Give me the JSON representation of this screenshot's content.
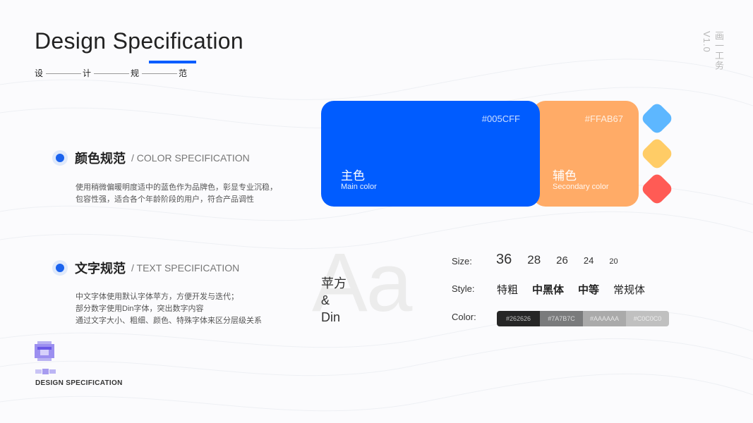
{
  "header": {
    "title": "Design Specification",
    "subtitle_chars": [
      "设",
      "计",
      "规",
      "范"
    ],
    "vertical_tag": "画一工务 V1.0"
  },
  "color_section": {
    "title_cn": "颜色规范",
    "title_en": "/ COLOR SPECIFICATION",
    "desc": [
      "使用稍微偏暖明度适中的蓝色作为品牌色，彰显专业沉稳，",
      "包容性强，适合各个年龄阶段的用户，符合产品调性"
    ],
    "primary": {
      "hex": "#005CFF",
      "cn": "主色",
      "en": "Main color",
      "color": "#005CFF"
    },
    "secondary": {
      "hex": "#FFAB67",
      "cn": "辅色",
      "en": "Secondary color",
      "color": "#FFAB67"
    },
    "swatches": [
      "#5DB7FF",
      "#FFCC66",
      "#FF5B55"
    ]
  },
  "text_section": {
    "title_cn": "文字规范",
    "title_en": "/ TEXT SPECIFICATION",
    "desc": [
      "中文字体使用默认字体苹方，方便开发与迭代；",
      "部分数字使用Din字体，突出数字内容",
      "通过文字大小、粗细、颜色、特殊字体来区分层级关系"
    ],
    "big_glyph": "Aa",
    "font_names": [
      "苹方",
      "&",
      "Din"
    ],
    "size_label": "Size:",
    "sizes": [
      "36",
      "28",
      "26",
      "24",
      "20"
    ],
    "style_label": "Style:",
    "styles": [
      "特粗",
      "中黑体",
      "中等",
      "常规体"
    ],
    "color_label": "Color:",
    "text_colors": [
      {
        "hex": "#262626",
        "color": "#262626"
      },
      {
        "hex": "#7A7B7C",
        "color": "#7A7B7C"
      },
      {
        "hex": "#AAAAAA",
        "color": "#AAAAAA"
      },
      {
        "hex": "#C0C0C0",
        "color": "#C0C0C0"
      }
    ]
  },
  "footer": {
    "label": "DESIGN SPECIFICATION"
  }
}
